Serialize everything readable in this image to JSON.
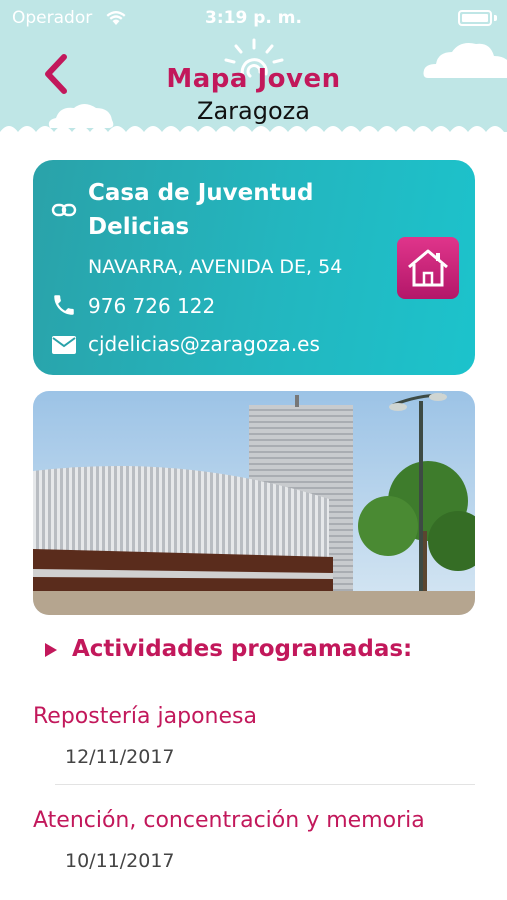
{
  "status_bar": {
    "carrier": "Operador",
    "time": "3:19 p. m."
  },
  "header": {
    "logo_title": "Mapa Joven",
    "logo_subtitle": "Zaragoza",
    "back_icon": "chevron-left-icon"
  },
  "center": {
    "name": "Casa de Juventud Delicias",
    "address": "NAVARRA, AVENIDA DE, 54",
    "phone": "976 726 122",
    "email": "cjdelicias@zaragoza.es"
  },
  "activities": {
    "title": "Actividades programadas:",
    "items": [
      {
        "title": "Repostería japonesa",
        "date": "12/11/2017"
      },
      {
        "title": "Atención, concentración y memoria",
        "date": "10/11/2017"
      }
    ]
  },
  "colors": {
    "header_bg": "#bfe6e6",
    "accent": "#c2185b",
    "card_teal": "#23b6bf",
    "home_button": "#d62a80"
  }
}
